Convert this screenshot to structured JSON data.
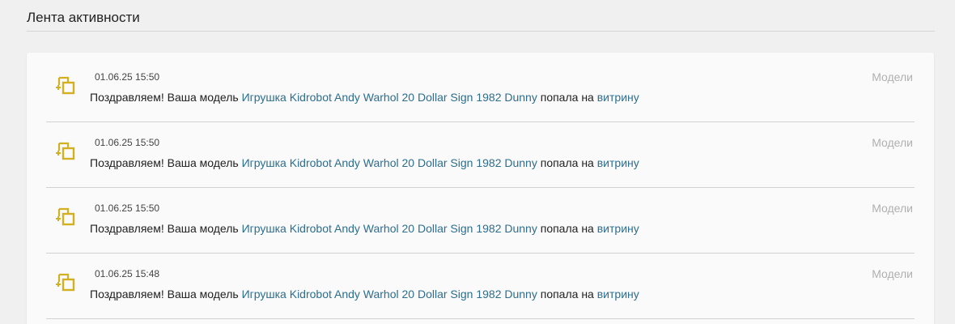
{
  "header": {
    "title": "Лента активности"
  },
  "colors": {
    "accent_link": "#2c6e8f",
    "icon": "#d2b020",
    "category": "#b0b0b0"
  },
  "feed": [
    {
      "icon": "model-showcase-icon",
      "time": "01.06.25 15:50",
      "category": "Модели",
      "prefix": "Поздравляем! Ваша модель",
      "model_link": "Игрушка Kidrobot Andy Warhol 20 Dollar Sign 1982 Dunny",
      "middle": "попала на",
      "showcase_link": "витрину"
    },
    {
      "icon": "model-showcase-icon",
      "time": "01.06.25 15:50",
      "category": "Модели",
      "prefix": "Поздравляем! Ваша модель",
      "model_link": "Игрушка Kidrobot Andy Warhol 20 Dollar Sign 1982 Dunny",
      "middle": "попала на",
      "showcase_link": "витрину"
    },
    {
      "icon": "model-showcase-icon",
      "time": "01.06.25 15:50",
      "category": "Модели",
      "prefix": "Поздравляем! Ваша модель",
      "model_link": "Игрушка Kidrobot Andy Warhol 20 Dollar Sign 1982 Dunny",
      "middle": "попала на",
      "showcase_link": "витрину"
    },
    {
      "icon": "model-showcase-icon",
      "time": "01.06.25 15:48",
      "category": "Модели",
      "prefix": "Поздравляем! Ваша модель",
      "model_link": "Игрушка Kidrobot Andy Warhol 20 Dollar Sign 1982 Dunny",
      "middle": "попала на",
      "showcase_link": "витрину"
    }
  ]
}
